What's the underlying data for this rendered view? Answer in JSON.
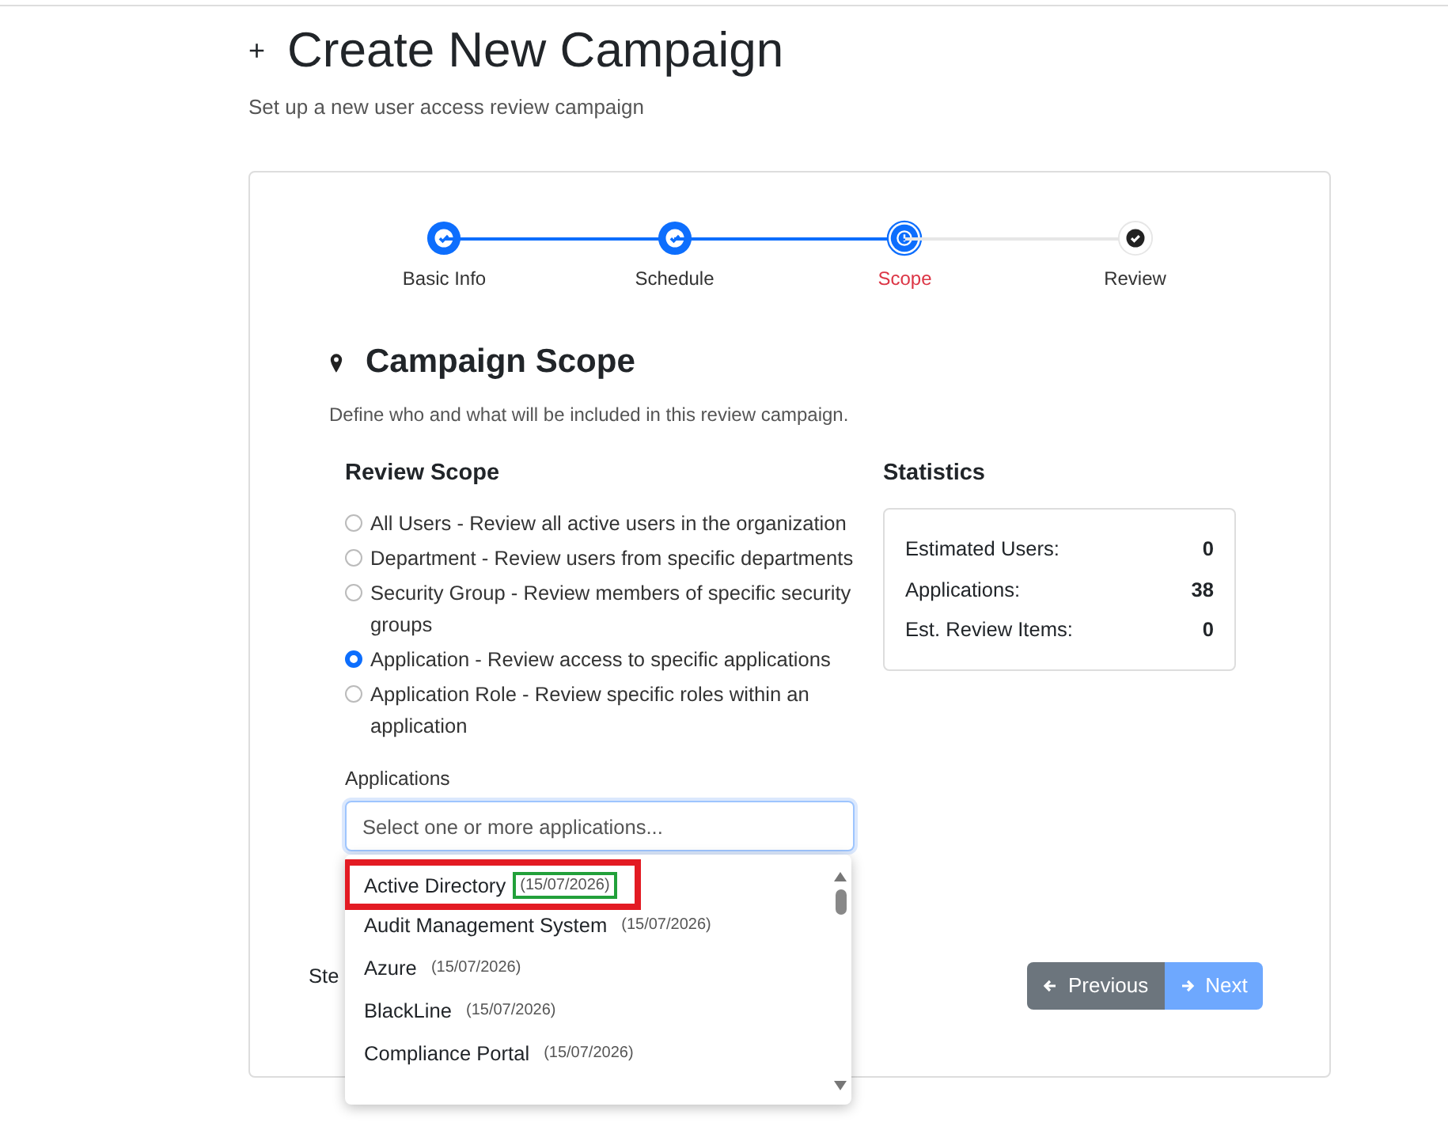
{
  "page": {
    "icon": "+",
    "title": "Create New Campaign",
    "subtitle": "Set up a new user access review campaign"
  },
  "steps": [
    {
      "label": "Basic Info",
      "completed": true,
      "selected": false
    },
    {
      "label": "Schedule",
      "completed": true,
      "selected": false
    },
    {
      "label": "Scope",
      "completed": false,
      "selected": true
    },
    {
      "label": "Review",
      "completed": false,
      "selected": false
    }
  ],
  "section": {
    "title": "Campaign Scope",
    "description": "Define who and what will be included in this review campaign."
  },
  "scope": {
    "heading": "Review Scope",
    "options": [
      {
        "label": "All Users - Review all active users in the organization",
        "selected": false
      },
      {
        "label": "Department - Review users from specific departments",
        "selected": false
      },
      {
        "label": "Security Group - Review members of specific security groups",
        "selected": false
      },
      {
        "label": "Application - Review access to specific applications",
        "selected": true
      },
      {
        "label": "Application Role - Review specific roles within an application",
        "selected": false
      }
    ]
  },
  "statistics": {
    "heading": "Statistics",
    "rows": [
      {
        "label": "Estimated Users:",
        "value": "0"
      },
      {
        "label": "Applications:",
        "value": "38"
      },
      {
        "label": "Est. Review Items:",
        "value": "0"
      }
    ]
  },
  "applications": {
    "label": "Applications",
    "placeholder": "Select one or more applications...",
    "options": [
      {
        "name": "Active Directory",
        "date": "(15/07/2026)",
        "highlighted": true,
        "date_highlighted": true
      },
      {
        "name": "Audit Management System",
        "date": "(15/07/2026)",
        "highlighted": false,
        "date_highlighted": false
      },
      {
        "name": "Azure",
        "date": "(15/07/2026)",
        "highlighted": false,
        "date_highlighted": false
      },
      {
        "name": "BlackLine",
        "date": "(15/07/2026)",
        "highlighted": false,
        "date_highlighted": false
      },
      {
        "name": "Compliance Portal",
        "date": "(15/07/2026)",
        "highlighted": false,
        "date_highlighted": false
      }
    ]
  },
  "footer": {
    "step_text": "Ste",
    "previous": "Previous",
    "next": "Next"
  }
}
